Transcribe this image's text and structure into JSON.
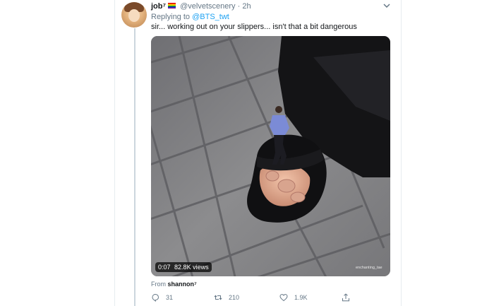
{
  "tweet": {
    "author_name": "job⁷",
    "author_handle": "@velvetscenery",
    "separator": "·",
    "time": "2h",
    "replying_prefix": "Replying to ",
    "replying_to": "@BTS_twt",
    "text": "sir... working out on your slippers... isn't that a bit dangerous"
  },
  "media": {
    "duration": "0:07",
    "views": "82.8K views",
    "watermark": "enchanting_tae"
  },
  "source": {
    "prefix": "From",
    "name": "shannon⁷"
  },
  "actions": {
    "reply_count": "31",
    "retweet_count": "210",
    "like_count": "1.9K"
  },
  "colors": {
    "accent": "#1da1f2",
    "secondary_text": "#657786",
    "primary_text": "#14171a"
  },
  "icons": [
    "rainbow-flag-icon",
    "chevron-down-icon",
    "reply-icon",
    "retweet-icon",
    "heart-icon",
    "share-icon"
  ]
}
